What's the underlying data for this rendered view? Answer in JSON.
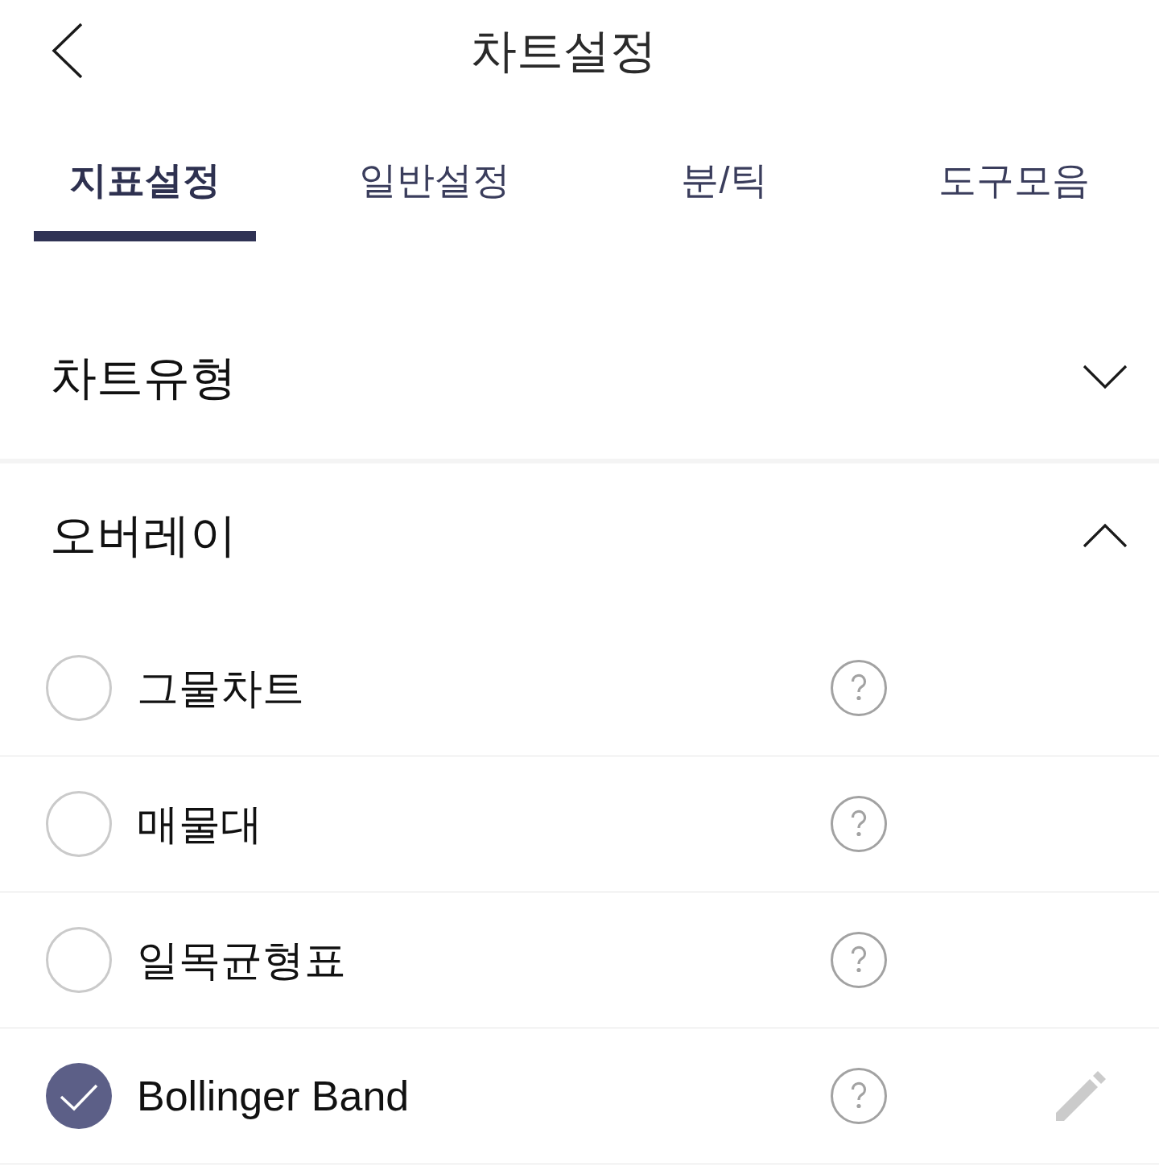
{
  "header": {
    "title": "차트설정"
  },
  "tabs": [
    {
      "label": "지표설정",
      "selected": true
    },
    {
      "label": "일반설정",
      "selected": false
    },
    {
      "label": "분/틱",
      "selected": false
    },
    {
      "label": "도구모음",
      "selected": false
    }
  ],
  "sections": [
    {
      "title": "차트유형",
      "expanded": false
    },
    {
      "title": "오버레이",
      "expanded": true,
      "items": [
        {
          "label": "그물차트",
          "checked": false,
          "editable": false
        },
        {
          "label": "매물대",
          "checked": false,
          "editable": false
        },
        {
          "label": "일목균형표",
          "checked": false,
          "editable": false
        },
        {
          "label": "Bollinger Band",
          "checked": true,
          "editable": true
        }
      ]
    }
  ]
}
